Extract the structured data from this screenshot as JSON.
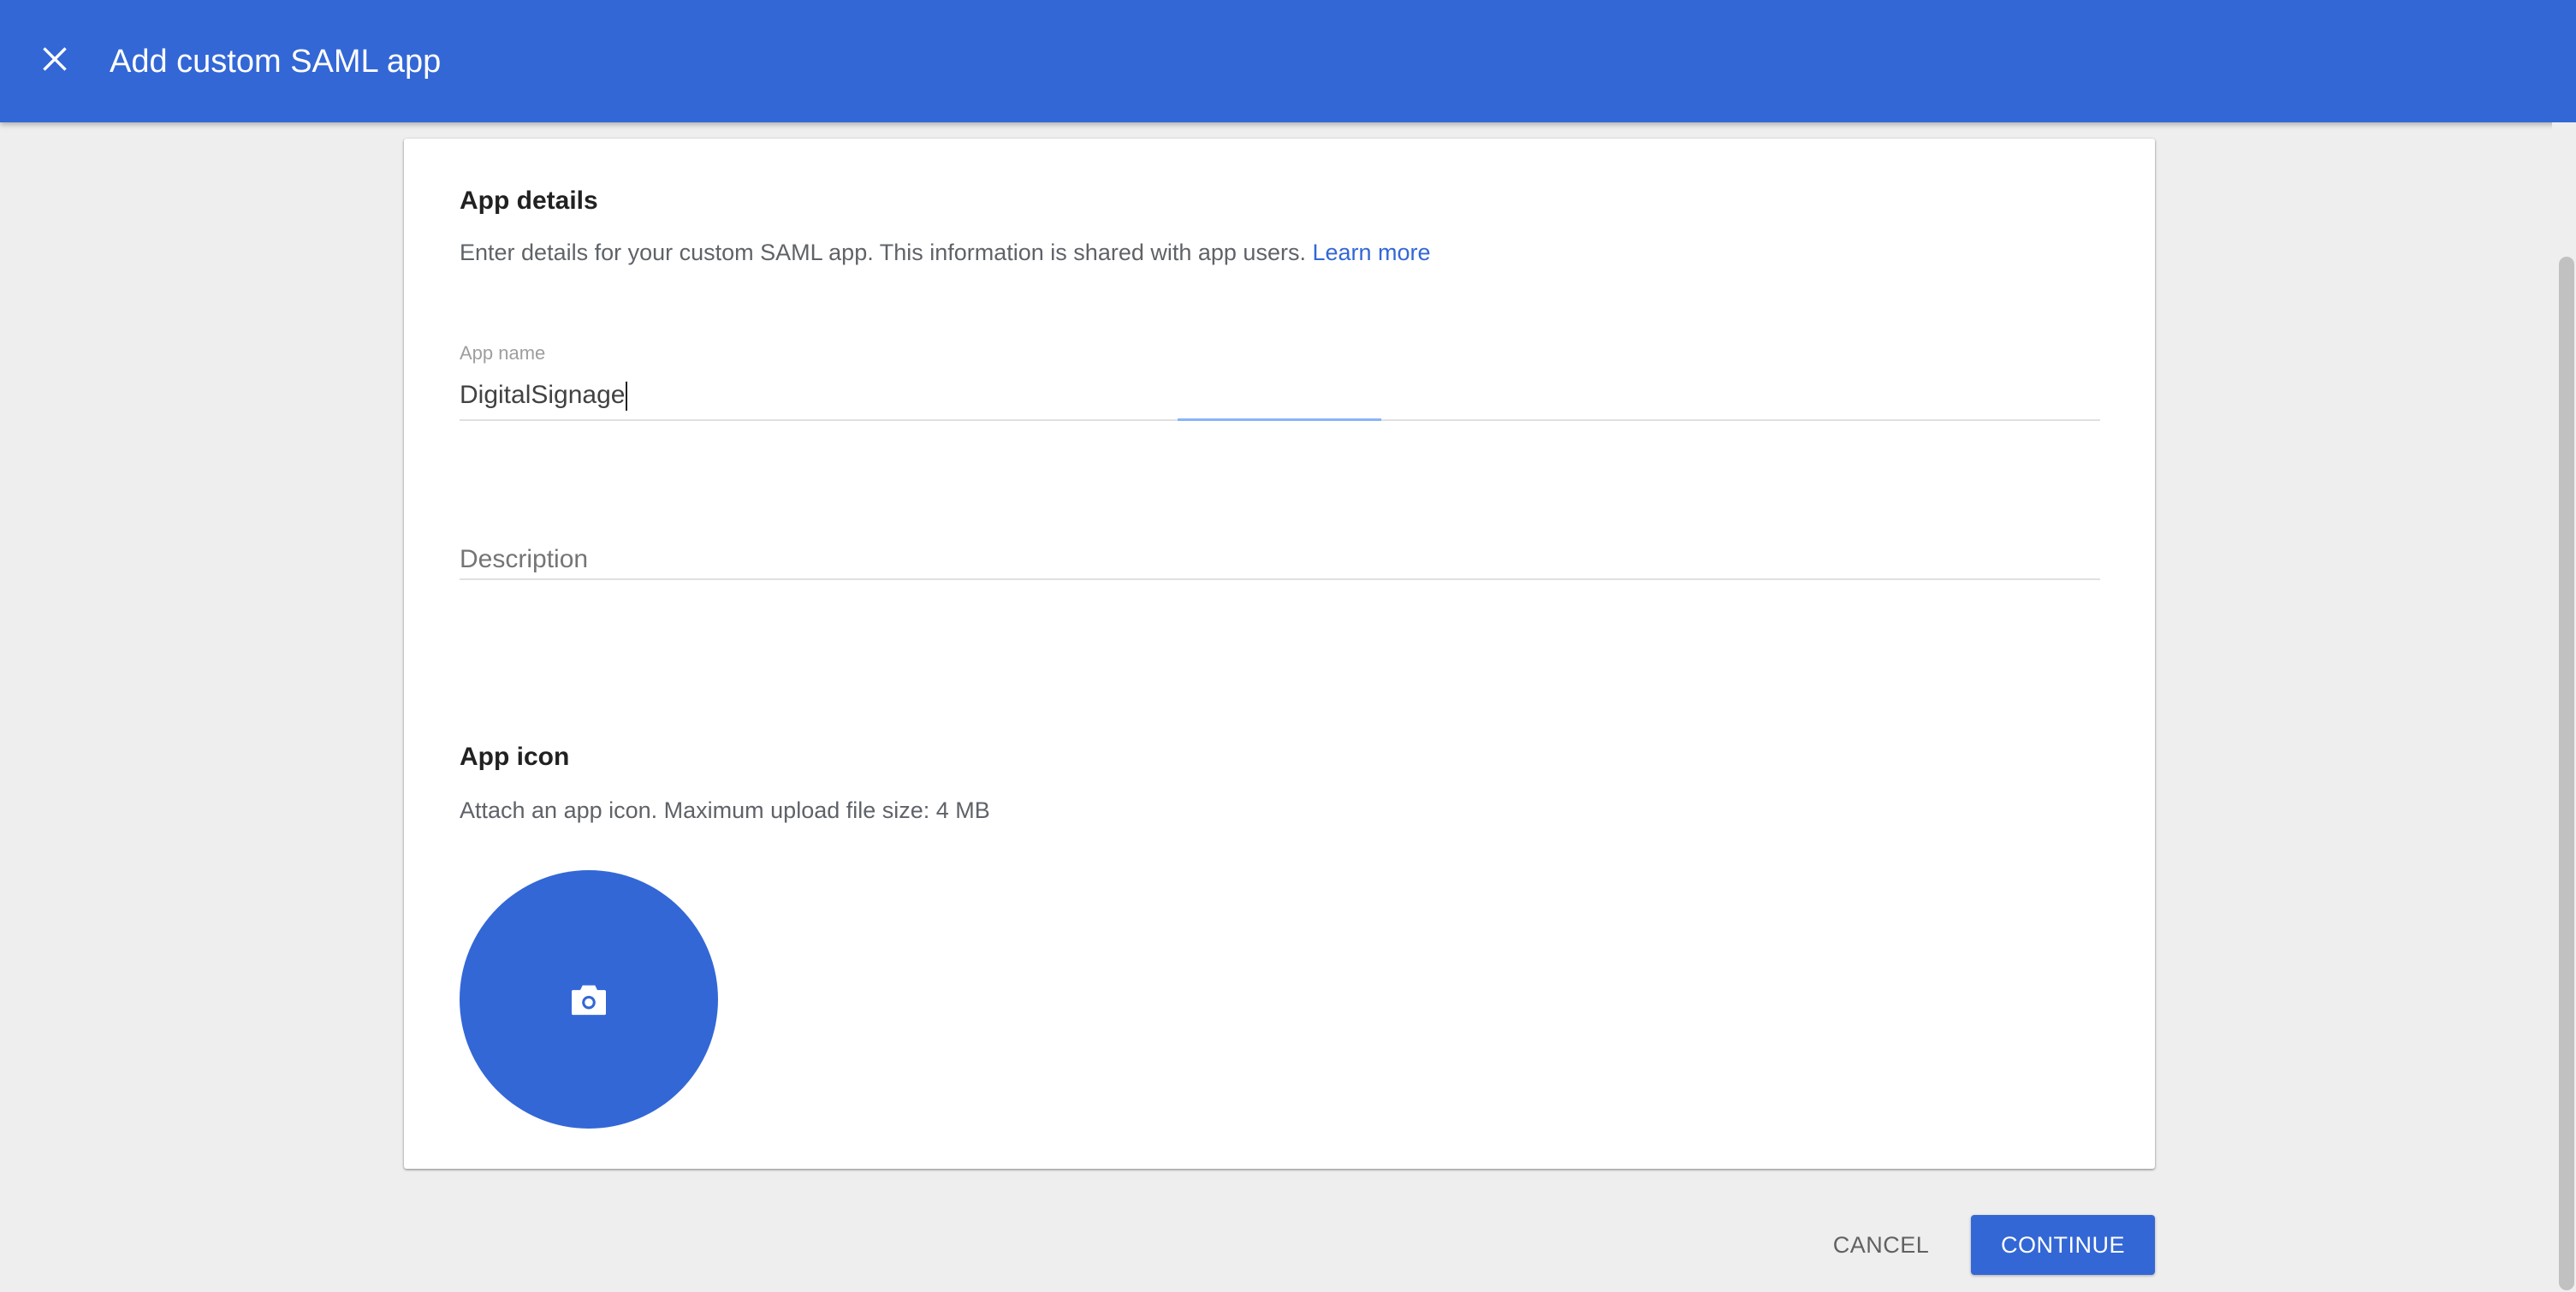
{
  "header": {
    "title": "Add custom SAML app",
    "close_icon": "close-icon"
  },
  "app_details": {
    "title": "App details",
    "description": "Enter details for your custom SAML app. This information is shared with app users.",
    "learn_more": "Learn more",
    "app_name_label": "App name",
    "app_name_value": "DigitalSignage",
    "description_placeholder": "Description",
    "description_value": ""
  },
  "app_icon": {
    "title": "App icon",
    "description": "Attach an app icon. Maximum upload file size: 4 MB",
    "icon": "camera-icon"
  },
  "footer": {
    "cancel_label": "CANCEL",
    "continue_label": "CONTINUE"
  },
  "colors": {
    "primary": "#3367d6",
    "background": "#eeeeee",
    "card": "#ffffff"
  }
}
